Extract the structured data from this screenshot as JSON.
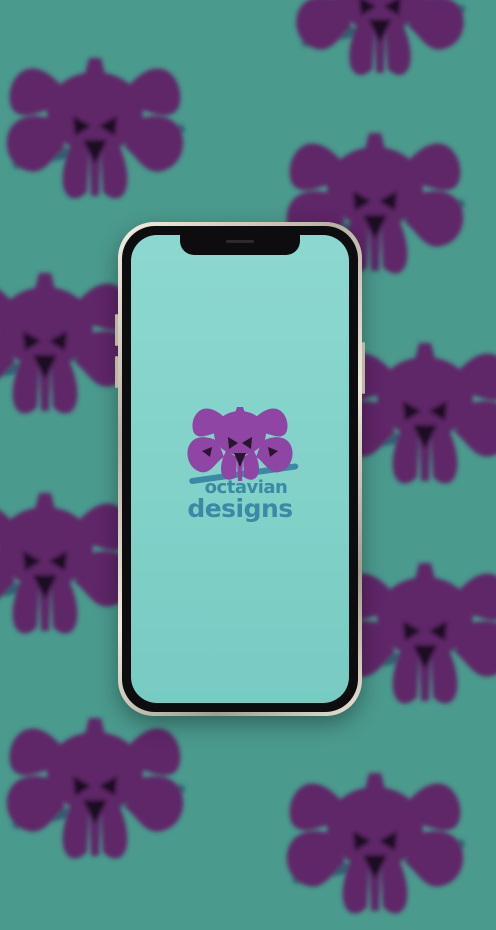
{
  "brand": {
    "name_line1": "octavian",
    "name_line2": "designs",
    "mascot_icon": "octopus-icon"
  },
  "colors": {
    "background": "#4b9a8e",
    "pattern_octopus": "#5e2568",
    "screen": "#80d1c8",
    "logo_octopus": "#8e45a4",
    "logo_text": "#3a8aa6"
  }
}
